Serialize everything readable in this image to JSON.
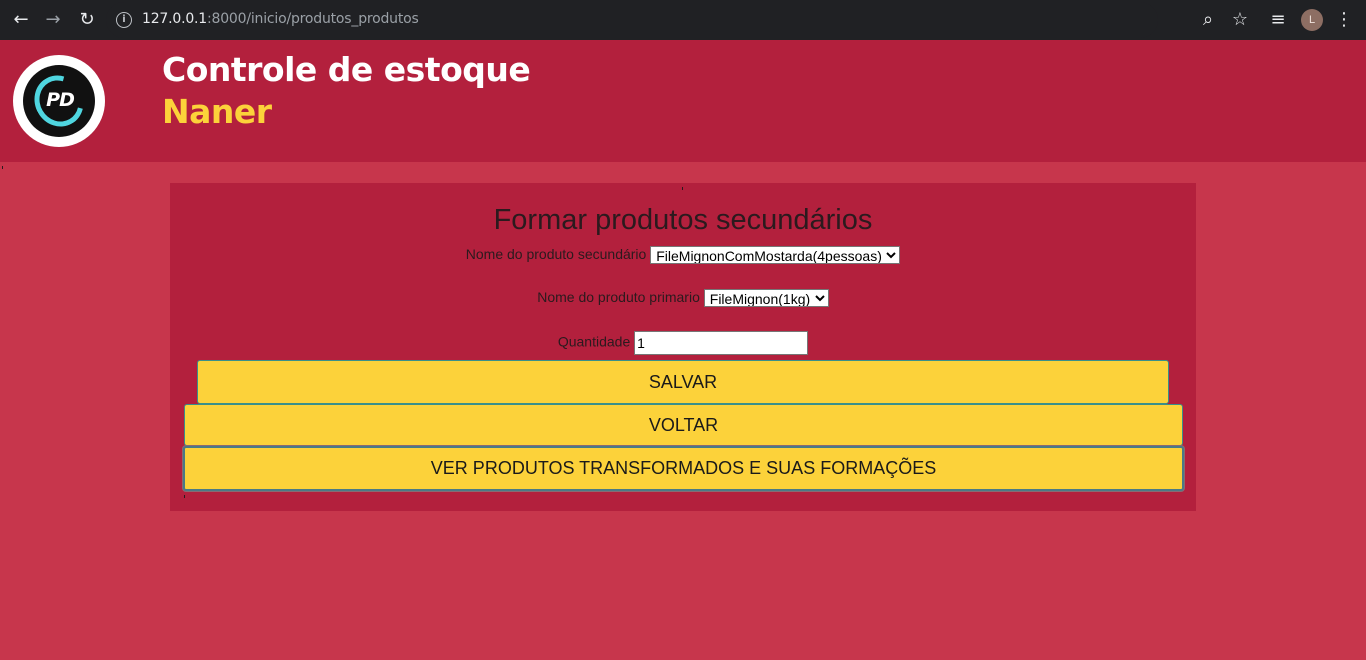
{
  "browser": {
    "url_host": "127.0.0.1",
    "url_path": ":8000/inicio/produtos_produtos",
    "avatar_letter": "L"
  },
  "header": {
    "logo_text": "PD",
    "title": "Controle de estoque",
    "subtitle": "Naner"
  },
  "form": {
    "title": "Formar produtos secundários",
    "secondary_label": "Nome do produto secundário",
    "secondary_value": "FileMignonComMostarda(4pessoas)",
    "primary_label": "Nome do produto primario",
    "primary_value": "FileMignon(1kg)",
    "quantity_label": "Quantidade",
    "quantity_value": "1",
    "save_label": "SALVAR",
    "back_label": "VOLTAR",
    "view_label": "VER PRODUTOS TRANSFORMADOS E SUAS FORMAÇÕES"
  },
  "colors": {
    "page_bg": "#c7364c",
    "header_bg": "#b3203d",
    "card_bg": "#b3203d",
    "button_bg": "#fcd23a",
    "subtitle_color": "#fcd23a"
  }
}
